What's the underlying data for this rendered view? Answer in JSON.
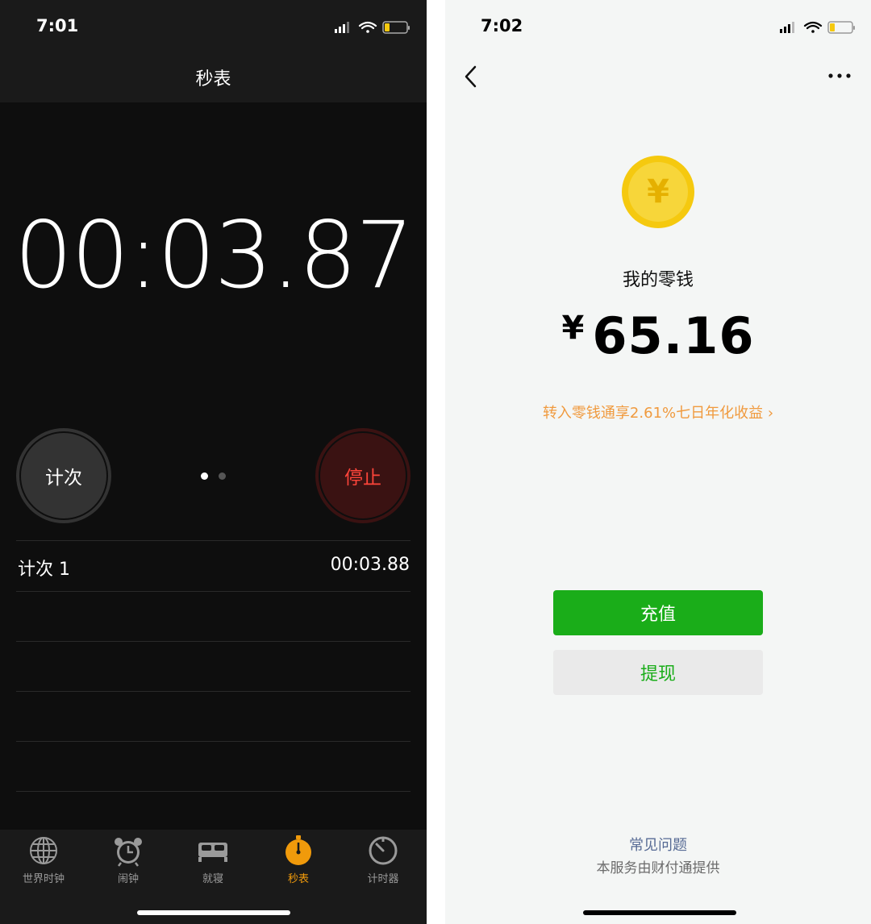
{
  "stopwatch": {
    "status_time": "7:01",
    "title": "秒表",
    "display": "00:03.87",
    "lap_button": "计次",
    "stop_button": "停止",
    "laps": [
      {
        "label": "计次 1",
        "time": "00:03.88"
      }
    ],
    "tabs": [
      {
        "label": "世界时钟",
        "icon": "globe-icon"
      },
      {
        "label": "闹钟",
        "icon": "alarm-clock-icon"
      },
      {
        "label": "就寝",
        "icon": "bed-icon"
      },
      {
        "label": "秒表",
        "icon": "stopwatch-icon",
        "active": true
      },
      {
        "label": "计时器",
        "icon": "timer-icon"
      }
    ],
    "colors": {
      "accent": "#f09a0b",
      "stop": "#ff453a"
    }
  },
  "wallet": {
    "status_time": "7:02",
    "currency_symbol": "¥",
    "coin_symbol": "¥",
    "balance_label": "我的零钱",
    "balance_amount": "65.16",
    "promo": "转入零钱通享2.61%七日年化收益 ›",
    "recharge_button": "充值",
    "withdraw_button": "提现",
    "faq_link": "常见问题",
    "provider_note": "本服务由财付通提供",
    "colors": {
      "primary": "#1aad19",
      "promo": "#f09a3e",
      "link": "#576b95",
      "coin": "#f5c90f"
    }
  }
}
